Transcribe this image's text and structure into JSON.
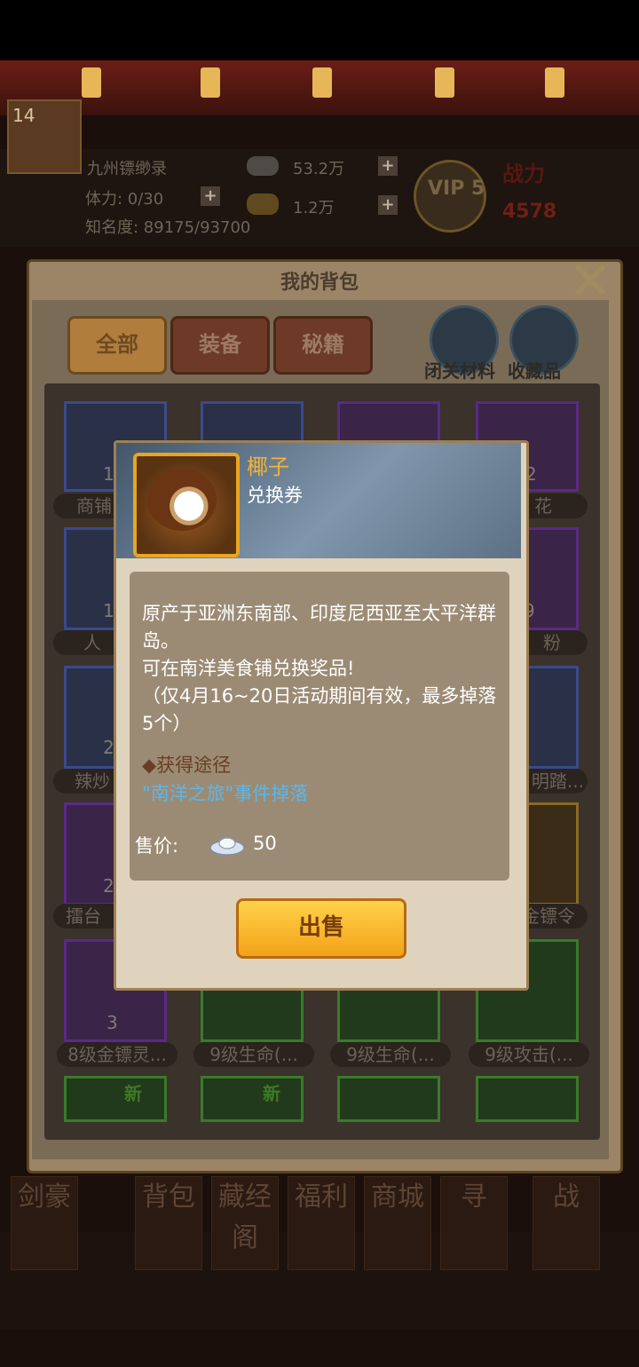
{
  "header": {
    "player_name": "九州镖缈录",
    "level": "14",
    "stamina": "体力: 0/30",
    "fame": "知名度: 89175/93700",
    "silver": "53.2万",
    "gold": "1.2万",
    "vip": "VIP 5",
    "power_label": "战力",
    "power_value": "4578"
  },
  "bag": {
    "title": "我的背包",
    "tabs": [
      {
        "label": "全部",
        "active": true
      },
      {
        "label": "装备",
        "active": false
      },
      {
        "label": "秘籍",
        "active": false
      }
    ],
    "side_buttons": [
      {
        "label": "闭关材料"
      },
      {
        "label": "收藏品"
      }
    ],
    "items": [
      {
        "label": "商铺",
        "count": "1"
      },
      {
        "label": "",
        "count": ""
      },
      {
        "label": "",
        "count": ""
      },
      {
        "label": "花",
        "count": "2"
      },
      {
        "label": "人",
        "count": "1"
      },
      {
        "label": "",
        "count": ""
      },
      {
        "label": "",
        "count": ""
      },
      {
        "label": "粉",
        "count": "9"
      },
      {
        "label": "辣炒",
        "count": "2"
      },
      {
        "label": "",
        "count": ""
      },
      {
        "label": "",
        "count": ""
      },
      {
        "label": "明踏...",
        "count": ""
      },
      {
        "label": "擂台",
        "count": "2"
      },
      {
        "label": "",
        "count": ""
      },
      {
        "label": "",
        "count": ""
      },
      {
        "label": "金镖令",
        "count": ""
      },
      {
        "label": "8级金镖灵...",
        "count": "3"
      },
      {
        "label": "9级生命(...",
        "count": ""
      },
      {
        "label": "9级生命(...",
        "count": ""
      },
      {
        "label": "9级攻击(...",
        "count": ""
      }
    ],
    "new_tag": "新"
  },
  "tooltip": {
    "name": "椰子",
    "type": "兑换券",
    "description": "原产于亚洲东南部、印度尼西亚至太平洋群岛。\n可在南洋美食铺兑换奖品!\n（仅4月16~20日活动期间有效，最多掉落5个）",
    "source_label": "◆获得途径",
    "source": "\"南洋之旅\"事件掉落",
    "price_label": "售价:",
    "price_value": "50",
    "sell_button": "出售"
  },
  "bottom_nav": [
    "剑豪",
    "背包",
    "藏经阁",
    "福利",
    "商城",
    "寻",
    "战"
  ],
  "colors": {
    "accent_gold": "#f5b233",
    "link_blue": "#5bb7ea",
    "sell_button": "#f2a218"
  }
}
